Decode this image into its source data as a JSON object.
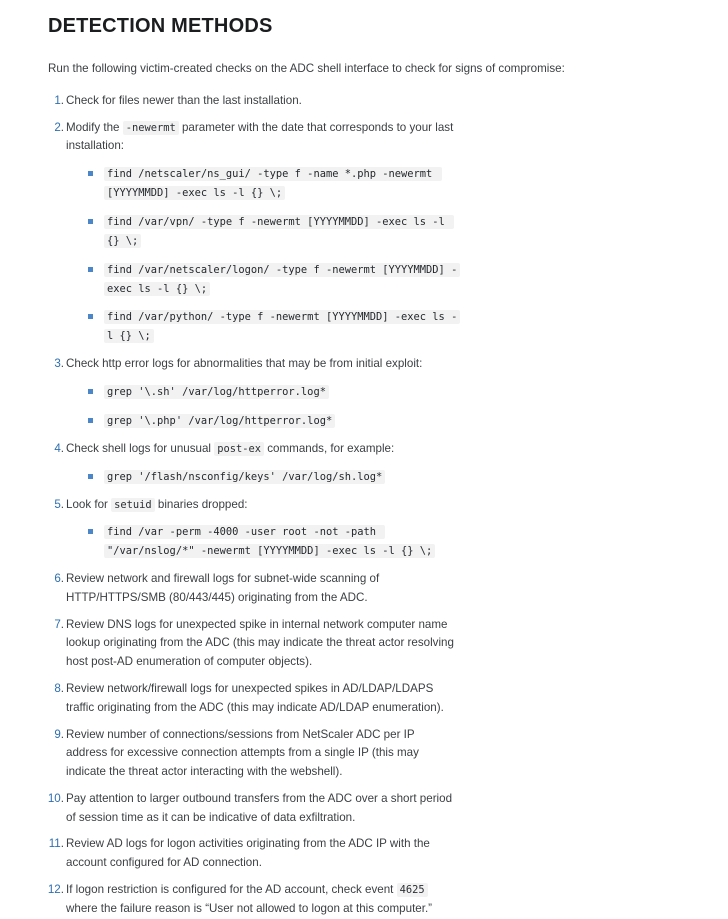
{
  "heading": "DETECTION METHODS",
  "intro": "Run the following victim-created checks on the ADC shell interface to check for signs of compromise:",
  "steps": [
    {
      "num": "1",
      "text": "Check for files newer than the last installation."
    },
    {
      "num": "2",
      "text_before": "Modify the ",
      "inline_code": "-newermt",
      "text_after": " parameter with the date that corresponds to your last installation:",
      "commands": [
        "find /netscaler/ns_gui/ -type f -name *.php -newermt [YYYYMMDD] -exec ls -l {} \\;",
        "find /var/vpn/ -type f -newermt [YYYYMMDD] -exec ls -l {} \\;",
        "find /var/netscaler/logon/ -type f -newermt [YYYYMMDD] -exec ls -l {} \\;",
        "find /var/python/ -type f -newermt [YYYYMMDD] -exec ls -l {} \\;"
      ]
    },
    {
      "num": "3",
      "text": "Check http error logs for abnormalities that may be from initial exploit:",
      "commands": [
        "grep '\\.sh' /var/log/httperror.log*",
        "grep '\\.php' /var/log/httperror.log*"
      ]
    },
    {
      "num": "4",
      "text_before": "Check shell logs for unusual ",
      "inline_code": "post-ex",
      "text_after": " commands, for example:",
      "commands": [
        "grep '/flash/nsconfig/keys' /var/log/sh.log*"
      ]
    },
    {
      "num": "5",
      "text_before": "Look for ",
      "inline_code": "setuid",
      "text_after": " binaries dropped:",
      "commands": [
        "find /var -perm -4000 -user root -not -path \"/var/nslog/*\" -newermt [YYYYMMDD] -exec ls -l {} \\;"
      ]
    },
    {
      "num": "6",
      "text": "Review network and firewall logs for subnet-wide scanning of HTTP/HTTPS/SMB (80/443/445) originating from the ADC."
    },
    {
      "num": "7",
      "text": "Review DNS logs for unexpected spike in internal network computer name lookup originating from the ADC (this may indicate the threat actor resolving host post-AD enumeration of computer objects)."
    },
    {
      "num": "8",
      "text": "Review network/firewall logs for unexpected spikes in AD/LDAP/LDAPS traffic originating from the ADC (this may indicate AD/LDAP enumeration)."
    },
    {
      "num": "9",
      "text": "Review number of connections/sessions from NetScaler ADC per IP address for excessive connection attempts from a single IP (this may indicate the threat actor interacting with the webshell)."
    },
    {
      "num": "10",
      "text": "Pay attention to larger outbound transfers from the ADC over a short period of session time as it can be indicative of data exfiltration."
    },
    {
      "num": "11",
      "text": "Review AD logs for logon activities originating from the ADC IP with the account configured for AD connection."
    },
    {
      "num": "12",
      "text_before": "If logon restriction is configured for the AD account, check event ",
      "inline_code": "4625",
      "text_after": " where the failure reason is “User not allowed to logon at this computer.”"
    }
  ],
  "colors": {
    "accent": "#2f6fb0",
    "bullet": "#4a86c8",
    "code_bg": "#f2f2f2",
    "text": "#3c4043",
    "heading": "#1c1d1f"
  }
}
